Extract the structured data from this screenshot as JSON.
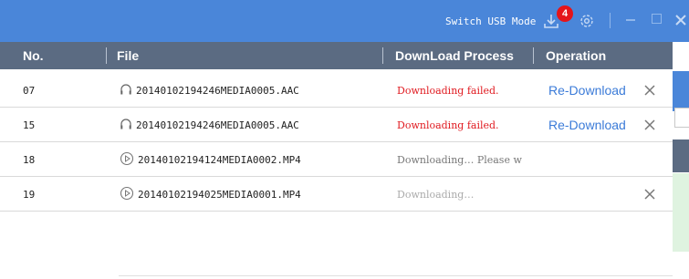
{
  "titlebar": {
    "switch_usb_mode_label": "Switch USB Mode",
    "download_badge_count": "4",
    "accent_color": "#4a86d9",
    "badge_color": "#e5141a"
  },
  "table": {
    "headers": {
      "no": "No.",
      "file": "File",
      "process": "DownLoad Process",
      "operation": "Operation"
    },
    "rows": [
      {
        "no": "07",
        "file_icon": "headphones-icon",
        "file": "20140102194246MEDIA0005.AAC",
        "status": "Downloading failed.",
        "status_type": "failed",
        "action": "Re-Download",
        "has_remove": true
      },
      {
        "no": "15",
        "file_icon": "headphones-icon",
        "file": "20140102194246MEDIA0005.AAC",
        "status": "Downloading failed.",
        "status_type": "failed",
        "action": "Re-Download",
        "has_remove": true
      },
      {
        "no": "18",
        "file_icon": "play-circle-icon",
        "file": "20140102194124MEDIA0002.MP4",
        "status": "Downloading… Please w",
        "status_type": "progress",
        "action": "",
        "has_remove": false
      },
      {
        "no": "19",
        "file_icon": "play-circle-icon",
        "file": "20140102194025MEDIA0001.MP4",
        "status": "Downloading…",
        "status_type": "pending",
        "action": "",
        "has_remove": true
      }
    ]
  }
}
